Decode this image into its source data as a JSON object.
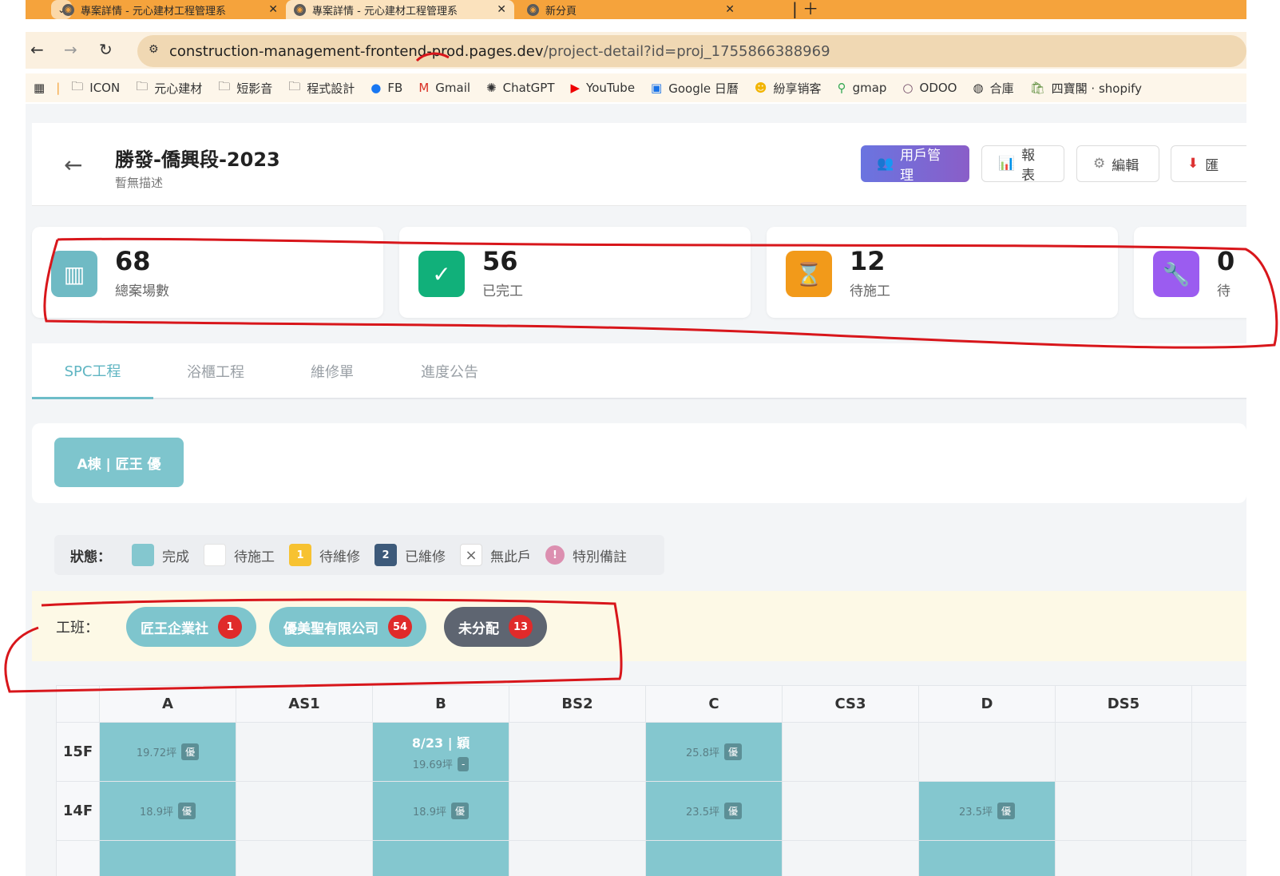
{
  "browser": {
    "tabs": [
      {
        "title": "專案詳情 - 元心建材工程管理系",
        "active": false
      },
      {
        "title": "專案詳情 - 元心建材工程管理系",
        "active": true
      },
      {
        "title": "新分頁",
        "active": false
      }
    ],
    "url_host": "construction-management-frontend-prod.pages.dev",
    "url_path": "/project-detail?id=proj_1755866388969",
    "bookmarks": [
      "ICON",
      "元心建材",
      "短影音",
      "程式設計",
      "FB",
      "Gmail",
      "ChatGPT",
      "YouTube",
      "Google 日曆",
      "紛享销客",
      "gmap",
      "ODOO",
      "合庫",
      "四寶閣 · shopify"
    ]
  },
  "header": {
    "title": "勝發-僑興段-2023",
    "description": "暫無描述",
    "buttons": {
      "users": "用戶管理",
      "report": "報表",
      "edit": "編輯",
      "export": "匯"
    }
  },
  "stats": [
    {
      "value": "68",
      "label": "總案場數",
      "color": "#6fbac4",
      "icon": "building-icon"
    },
    {
      "value": "56",
      "label": "已完工",
      "color": "#11b07a",
      "icon": "check-icon"
    },
    {
      "value": "12",
      "label": "待施工",
      "color": "#f29a1a",
      "icon": "hourglass-icon"
    },
    {
      "value": "0",
      "label": "待",
      "color": "#9b5cf0",
      "icon": "wrench-icon"
    }
  ],
  "tabs": [
    "SPC工程",
    "浴櫃工程",
    "維修單",
    "進度公告"
  ],
  "building": "A棟 | 匠王 優",
  "legend": {
    "title": "狀態：",
    "items": [
      {
        "label": "完成",
        "color": "#84c7cf",
        "text": ""
      },
      {
        "label": "待施工",
        "color": "#ffffff",
        "text": ""
      },
      {
        "label": "待維修",
        "color": "#f7c231",
        "text": "1"
      },
      {
        "label": "已維修",
        "color": "#3d5a7a",
        "text": "2"
      },
      {
        "label": "無此戶",
        "color": "#ffffff",
        "text": "×"
      },
      {
        "label": "特別備註",
        "color": "#dc8fb0",
        "text": "!"
      }
    ]
  },
  "crews": {
    "label": "工班：",
    "items": [
      {
        "name": "匠王企業社",
        "count": "1",
        "color": "#7ec5cd"
      },
      {
        "name": "優美聖有限公司",
        "count": "54",
        "color": "#7ec5cd"
      },
      {
        "name": "未分配",
        "count": "13",
        "color": "#5e6571"
      }
    ]
  },
  "grid": {
    "columns": [
      "A",
      "AS1",
      "B",
      "BS2",
      "C",
      "CS3",
      "D",
      "DS5"
    ],
    "rows": [
      {
        "floor": "15F",
        "cells": [
          {
            "status": "done",
            "area": "19.72坪",
            "tag": "優"
          },
          null,
          {
            "status": "done",
            "date": "8/23 | 穎",
            "area": "19.69坪",
            "tag": "-"
          },
          null,
          {
            "status": "done",
            "area": "25.8坪",
            "tag": "優"
          },
          null,
          null,
          null
        ]
      },
      {
        "floor": "14F",
        "cells": [
          {
            "status": "done",
            "area": "18.9坪",
            "tag": "優"
          },
          null,
          {
            "status": "done",
            "area": "18.9坪",
            "tag": "優"
          },
          null,
          {
            "status": "done",
            "area": "23.5坪",
            "tag": "優"
          },
          null,
          {
            "status": "done",
            "area": "23.5坪",
            "tag": "優"
          },
          null
        ]
      }
    ]
  }
}
